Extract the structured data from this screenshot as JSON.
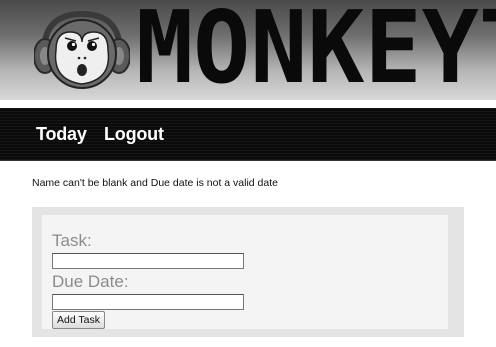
{
  "header": {
    "logo_text": "MONKEYT",
    "logo_icon": "monkey-face-icon"
  },
  "nav": {
    "today_label": "Today",
    "logout_label": "Logout"
  },
  "error": {
    "message": "Name can't be blank and Due date is not a valid date"
  },
  "form": {
    "task_label": "Task:",
    "task_value": "",
    "due_label": "Due Date:",
    "due_value": "",
    "submit_label": "Add Task"
  }
}
